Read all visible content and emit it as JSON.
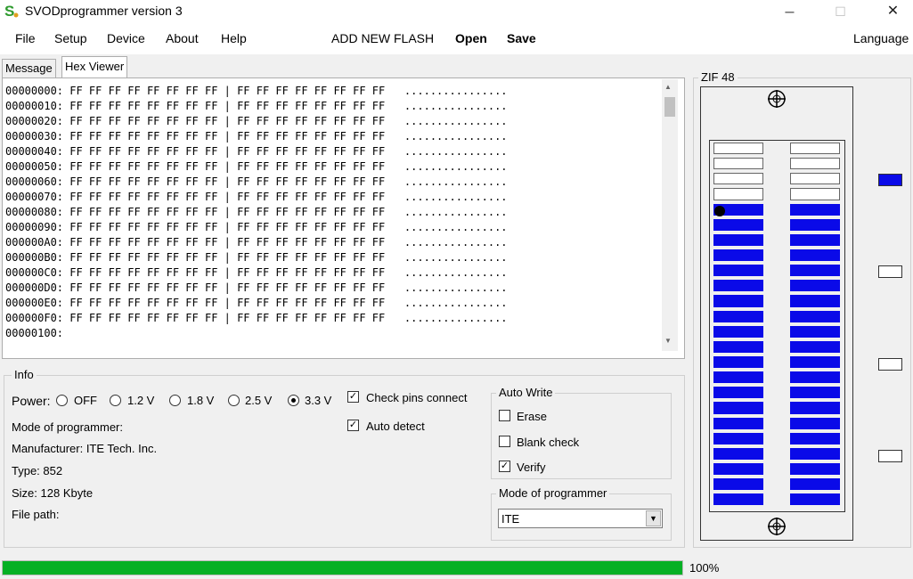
{
  "window": {
    "title": "SVODprogrammer version 3",
    "minimize": "─",
    "maximize": "☐",
    "close": "✕"
  },
  "menu": {
    "file": "File",
    "setup": "Setup",
    "device": "Device",
    "about": "About",
    "help": "Help",
    "add_new_flash": "ADD NEW FLASH",
    "open": "Open",
    "save": "Save",
    "language": "Language"
  },
  "tabs": {
    "message": "Message",
    "hex_viewer": "Hex Viewer"
  },
  "hex": {
    "lines": [
      "00000000: FF FF FF FF FF FF FF FF | FF FF FF FF FF FF FF FF   ................",
      "00000010: FF FF FF FF FF FF FF FF | FF FF FF FF FF FF FF FF   ................",
      "00000020: FF FF FF FF FF FF FF FF | FF FF FF FF FF FF FF FF   ................",
      "00000030: FF FF FF FF FF FF FF FF | FF FF FF FF FF FF FF FF   ................",
      "00000040: FF FF FF FF FF FF FF FF | FF FF FF FF FF FF FF FF   ................",
      "00000050: FF FF FF FF FF FF FF FF | FF FF FF FF FF FF FF FF   ................",
      "00000060: FF FF FF FF FF FF FF FF | FF FF FF FF FF FF FF FF   ................",
      "00000070: FF FF FF FF FF FF FF FF | FF FF FF FF FF FF FF FF   ................",
      "00000080: FF FF FF FF FF FF FF FF | FF FF FF FF FF FF FF FF   ................",
      "00000090: FF FF FF FF FF FF FF FF | FF FF FF FF FF FF FF FF   ................",
      "000000A0: FF FF FF FF FF FF FF FF | FF FF FF FF FF FF FF FF   ................",
      "000000B0: FF FF FF FF FF FF FF FF | FF FF FF FF FF FF FF FF   ................",
      "000000C0: FF FF FF FF FF FF FF FF | FF FF FF FF FF FF FF FF   ................",
      "000000D0: FF FF FF FF FF FF FF FF | FF FF FF FF FF FF FF FF   ................",
      "000000E0: FF FF FF FF FF FF FF FF | FF FF FF FF FF FF FF FF   ................",
      "000000F0: FF FF FF FF FF FF FF FF | FF FF FF FF FF FF FF FF   ................",
      "00000100:"
    ]
  },
  "info": {
    "title": "Info",
    "power_label": "Power:",
    "power_options": [
      "OFF",
      "1.2 V",
      "1.8 V",
      "2.5 V",
      "3.3 V"
    ],
    "power_selected": "3.3 V",
    "mode_label": "Mode of programmer:",
    "manufacturer": "Manufacturer: ITE Tech. Inc.",
    "type": "Type: 852",
    "size": "Size: 128 Kbyte",
    "file_path": "File path:",
    "check_pins": {
      "label": "Check pins connect",
      "checked": true
    },
    "auto_detect": {
      "label": "Auto detect",
      "checked": true
    }
  },
  "auto_write": {
    "title": "Auto Write",
    "erase": {
      "label": "Erase",
      "checked": false
    },
    "blank_check": {
      "label": "Blank check",
      "checked": false
    },
    "verify": {
      "label": "Verify",
      "checked": true
    }
  },
  "mode_select": {
    "title": "Mode of programmer",
    "value": "ITE"
  },
  "zif": {
    "title": "ZIF 48",
    "pins_per_side": 24,
    "inactive_top_pins": 4,
    "pin1_marked": true,
    "indicators": [
      true,
      false,
      false,
      false
    ],
    "active_color": "#0a0ae8"
  },
  "progress": {
    "value": 1.0,
    "label": "100%",
    "color": "#06b025"
  }
}
